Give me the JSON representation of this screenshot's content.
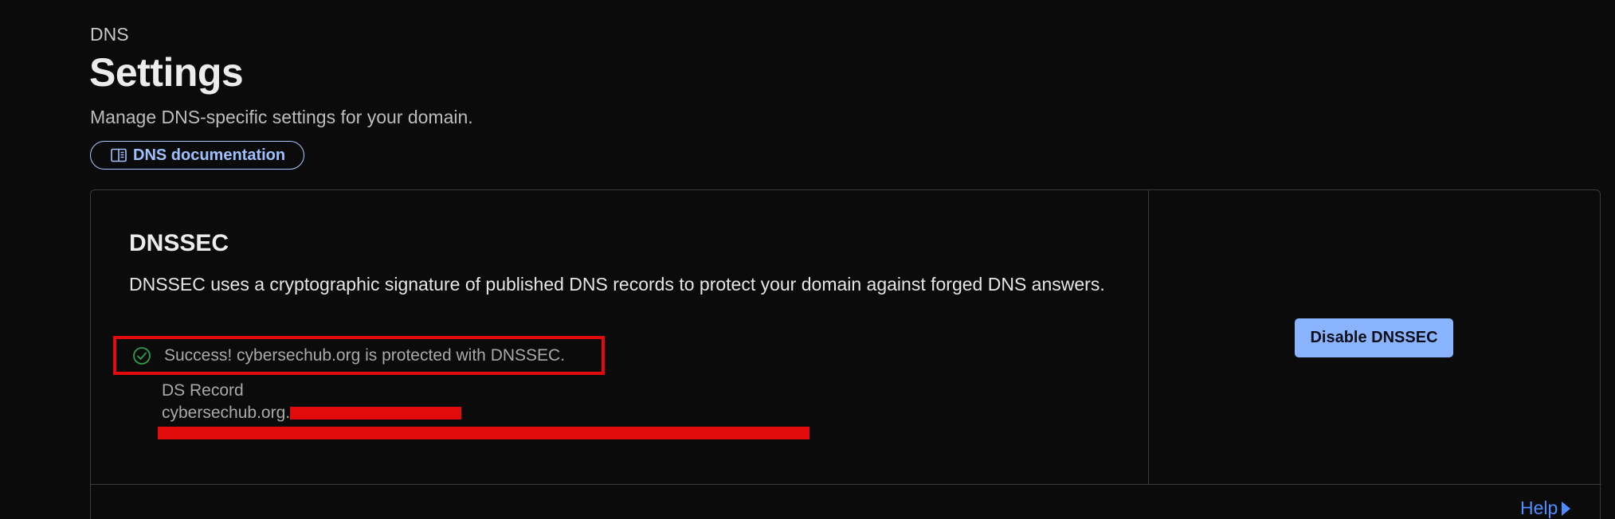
{
  "header": {
    "breadcrumb": "DNS",
    "title": "Settings",
    "description": "Manage DNS-specific settings for your domain.",
    "doc_link": {
      "label": "DNS documentation",
      "icon": "book-icon"
    }
  },
  "dnssec": {
    "title": "DNSSEC",
    "description": "DNSSEC uses a cryptographic signature of published DNS records to protect your domain against forged DNS answers.",
    "status": {
      "icon": "check-circle-icon",
      "text": "Success! cybersechub.org is protected with DNSSEC."
    },
    "ds_record": {
      "label": "DS Record",
      "value_prefix": "cybersechub.org."
    },
    "action_button": {
      "label": "Disable DNSSEC"
    }
  },
  "footer": {
    "help_label": "Help"
  },
  "colors": {
    "background": "#0b0b0b",
    "accent_link": "#9ec0ff",
    "primary_button": "#8ab4ff",
    "success": "#2e9e46",
    "annotation_red": "#e10b0b",
    "help_link": "#4f8cff"
  }
}
